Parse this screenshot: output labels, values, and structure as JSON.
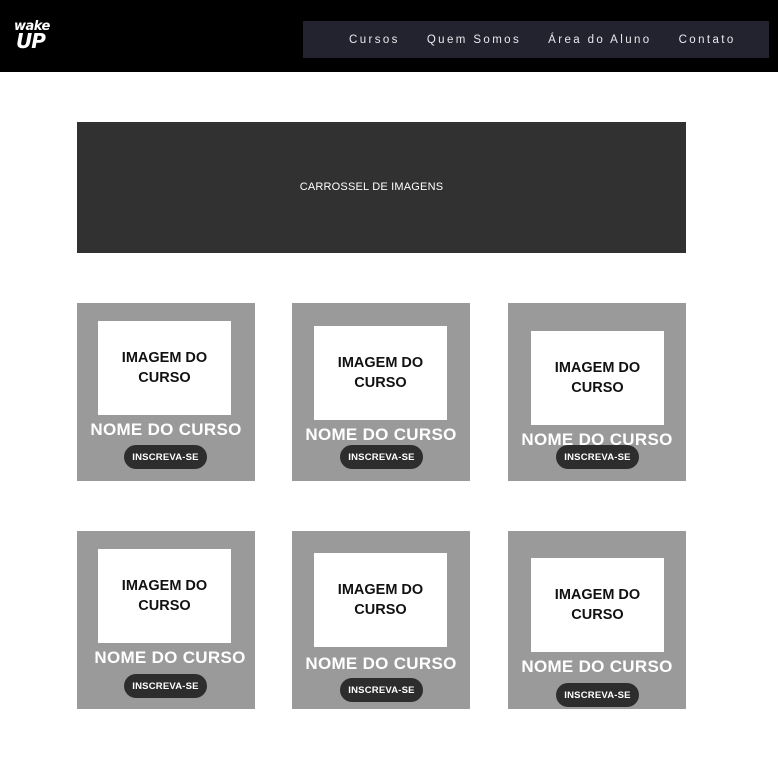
{
  "header": {
    "logo_line1": "wake",
    "logo_line2": "UP",
    "nav": [
      "Cursos",
      "Quem Somos",
      "Área do Aluno",
      "Contato"
    ]
  },
  "carousel": {
    "label": "CARROSSEL DE IMAGENS"
  },
  "courses": [
    {
      "image_label": "IMAGEM DO\nCURSO",
      "name": "NOME DO CURSO",
      "button": "INSCREVA-SE"
    },
    {
      "image_label": "IMAGEM DO\nCURSO",
      "name": "NOME DO CURSO",
      "button": "INSCREVA-SE"
    },
    {
      "image_label": "IMAGEM DO\nCURSO",
      "name": "NOME DO CURSO",
      "button": "INSCREVA-SE"
    },
    {
      "image_label": "IMAGEM DO\nCURSO",
      "name": "NOME DO CURSO",
      "button": "INSCREVA-SE"
    },
    {
      "image_label": "IMAGEM DO\nCURSO",
      "name": "NOME DO CURSO",
      "button": "INSCREVA-SE"
    },
    {
      "image_label": "IMAGEM DO\nCURSO",
      "name": "NOME DO CURSO",
      "button": "INSCREVA-SE"
    }
  ],
  "colors": {
    "header_bg": "#000000",
    "nav_bg": "#23232f",
    "carousel_bg": "#313131",
    "card_bg": "#9a9a9a",
    "button_bg": "#2d2d2d"
  }
}
